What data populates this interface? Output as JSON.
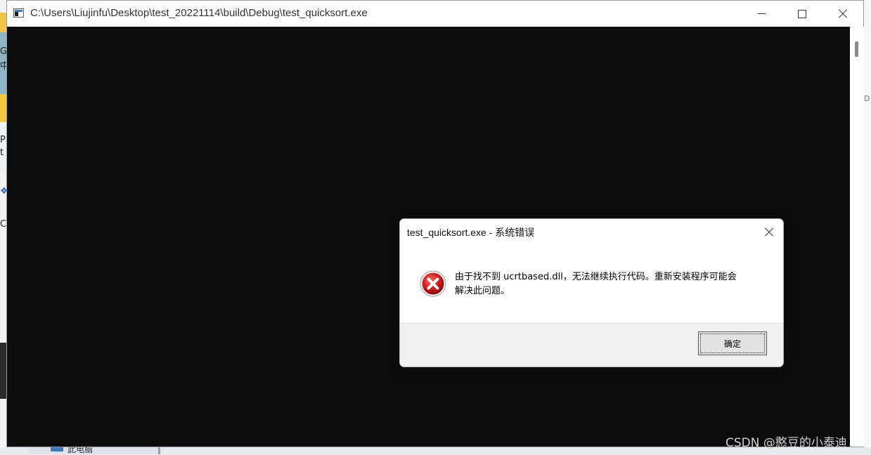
{
  "background": {
    "left_fragments": [
      "G",
      "中",
      "P",
      "t",
      "❖",
      "C"
    ],
    "right_fragment": "D",
    "taskbar_item_label": "此电脑"
  },
  "console_window": {
    "title": "C:\\Users\\Liujinfu\\Desktop\\test_20221114\\build\\Debug\\test_quicksort.exe",
    "background_color": "#0c0c0c",
    "controls": [
      "minimize-icon",
      "maximize-icon",
      "close-icon"
    ]
  },
  "error_dialog": {
    "title": "test_quicksort.exe - 系统错误",
    "message_line1": "由于找不到 ucrtbased.dll，无法继续执行代码。重新安装程序可能会",
    "message_line2": "解决此问题。",
    "ok_label": "确定",
    "icon": "error-icon",
    "icon_color": "#c8102e"
  },
  "watermark": "CSDN @憨豆的小泰迪"
}
